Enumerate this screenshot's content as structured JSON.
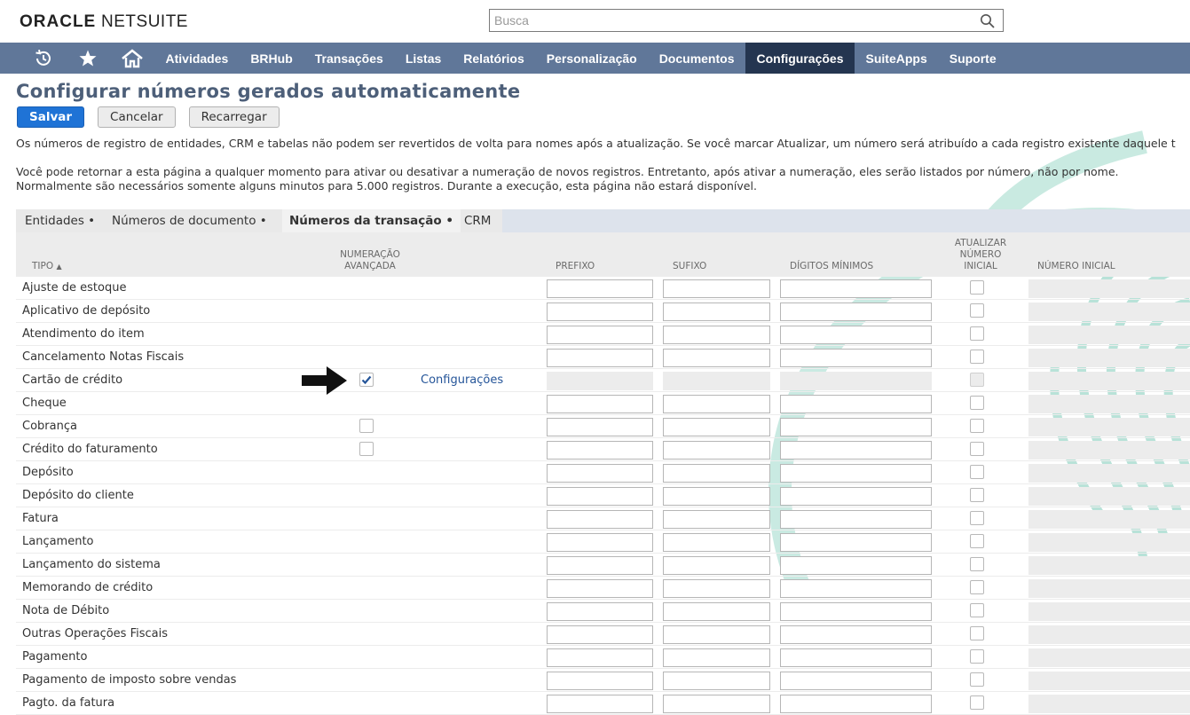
{
  "brand": {
    "logo_oracle": "ORACLE",
    "logo_netsuite": "NETSUITE"
  },
  "search": {
    "placeholder": "Busca",
    "icon": "search-icon"
  },
  "nav": {
    "icons": [
      "recent-records-icon",
      "star-icon",
      "home-icon"
    ],
    "items": [
      {
        "label": "Atividades",
        "active": false
      },
      {
        "label": "BRHub",
        "active": false
      },
      {
        "label": "Transações",
        "active": false
      },
      {
        "label": "Listas",
        "active": false
      },
      {
        "label": "Relatórios",
        "active": false
      },
      {
        "label": "Personalização",
        "active": false
      },
      {
        "label": "Documentos",
        "active": false
      },
      {
        "label": "Configurações",
        "active": true
      },
      {
        "label": "SuiteApps",
        "active": false
      },
      {
        "label": "Suporte",
        "active": false
      }
    ],
    "bg_color": "#607799",
    "active_color": "#243550"
  },
  "page": {
    "title": "Configurar números gerados automaticamente",
    "buttons": {
      "save": "Salvar",
      "cancel": "Cancelar",
      "reload": "Recarregar"
    },
    "info1": "Os números de registro de entidades, CRM e tabelas não podem ser revertidos de volta para nomes após a atualização. Se você marcar Atualizar, um número será atribuído a cada registro existente daquele t",
    "info2a": "Você pode retornar a esta página a qualquer momento para ativar ou desativar a numeração de novos registros. Entretanto, após ativar a numeração, eles serão listados por número, não por nome.",
    "info2b": "Normalmente são necessários somente alguns minutos para 5.000 registros. Durante a execução, esta página não estará disponível."
  },
  "tabs": [
    {
      "label": "Entidades",
      "active": false
    },
    {
      "label": "Números de documento",
      "active": false
    },
    {
      "label": "Números da transação",
      "active": true
    },
    {
      "label": "CRM",
      "active": false
    }
  ],
  "table": {
    "headers": {
      "tipo": "TIPO",
      "numeracao_line1": "NUMERAÇÃO",
      "numeracao_line2": "AVANÇADA",
      "prefixo": "PREFIXO",
      "sufixo": "SUFIXO",
      "digitos": "DÍGITOS MÍNIMOS",
      "atualizar_line1": "ATUALIZAR",
      "atualizar_line2": "NÚMERO",
      "atualizar_line3": "INICIAL",
      "numero_inicial": "NÚMERO INICIAL"
    },
    "sort_indicator": "▲",
    "config_link": "Configurações",
    "rows": [
      {
        "tipo": "Ajuste de estoque",
        "advanced": null,
        "configured": false
      },
      {
        "tipo": "Aplicativo de depósito",
        "advanced": null,
        "configured": false
      },
      {
        "tipo": "Atendimento do item",
        "advanced": null,
        "configured": false
      },
      {
        "tipo": "Cancelamento Notas Fiscais",
        "advanced": null,
        "configured": false
      },
      {
        "tipo": "Cartão de crédito",
        "advanced": true,
        "configured": true
      },
      {
        "tipo": "Cheque",
        "advanced": null,
        "configured": false
      },
      {
        "tipo": "Cobrança",
        "advanced": false,
        "configured": false
      },
      {
        "tipo": "Crédito do faturamento",
        "advanced": false,
        "configured": false
      },
      {
        "tipo": "Depósito",
        "advanced": null,
        "configured": false
      },
      {
        "tipo": "Depósito do cliente",
        "advanced": null,
        "configured": false
      },
      {
        "tipo": "Fatura",
        "advanced": null,
        "configured": false
      },
      {
        "tipo": "Lançamento",
        "advanced": null,
        "configured": false
      },
      {
        "tipo": "Lançamento do sistema",
        "advanced": null,
        "configured": false
      },
      {
        "tipo": "Memorando de crédito",
        "advanced": null,
        "configured": false
      },
      {
        "tipo": "Nota de Débito",
        "advanced": null,
        "configured": false
      },
      {
        "tipo": "Outras Operações Fiscais",
        "advanced": null,
        "configured": false
      },
      {
        "tipo": "Pagamento",
        "advanced": null,
        "configured": false
      },
      {
        "tipo": "Pagamento de imposto sobre vendas",
        "advanced": null,
        "configured": false
      },
      {
        "tipo": "Pagto. da fatura",
        "advanced": null,
        "configured": false
      }
    ]
  },
  "annotation": {
    "arrow_icon": "pointer-arrow-icon"
  },
  "colors": {
    "title": "#4d5f79",
    "primary_button": "#1f73d6",
    "link": "#255599",
    "watermark": "#9fd6c8"
  }
}
